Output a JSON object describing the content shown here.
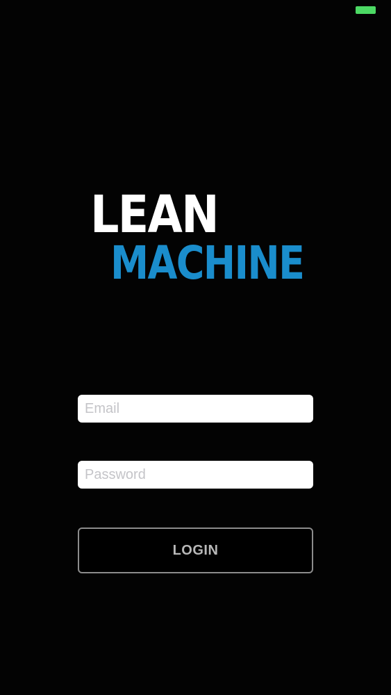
{
  "status_bar": {
    "battery_color": "#4cd964"
  },
  "logo": {
    "line1": "LEAN",
    "line2": "MACHINE",
    "line1_color": "#ffffff",
    "line2_color": "#1a8dcc"
  },
  "login_form": {
    "email": {
      "value": "",
      "placeholder": "Email"
    },
    "password": {
      "value": "",
      "placeholder": "Password"
    },
    "login_label": "LOGIN"
  }
}
